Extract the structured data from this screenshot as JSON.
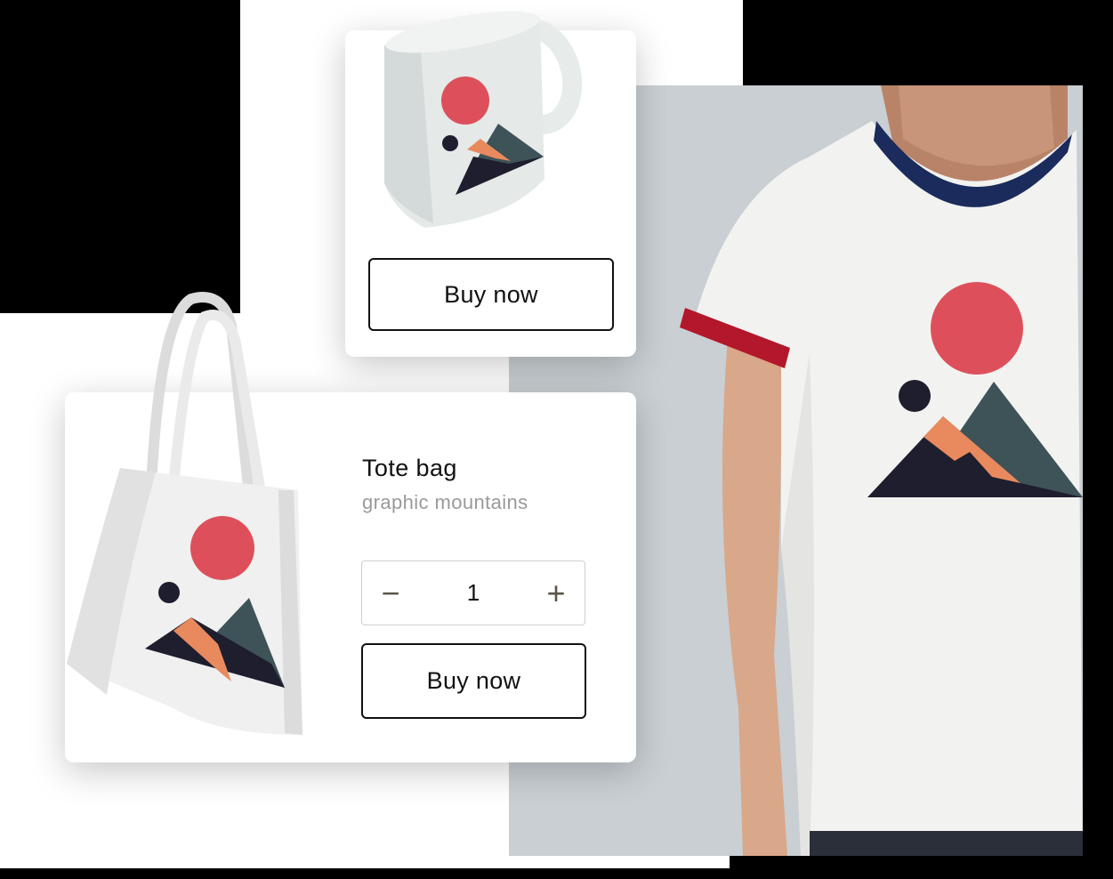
{
  "mug": {
    "buy_label": "Buy now",
    "image_icon": "mug-graphic-mountains"
  },
  "tote": {
    "title": "Tote bag",
    "subtitle": "graphic mountains",
    "quantity": "1",
    "decrement_symbol": "−",
    "increment_symbol": "+",
    "buy_label": "Buy now",
    "image_icon": "tote-bag-graphic-mountains"
  },
  "tshirt": {
    "image_icon": "tshirt-model-graphic-mountains"
  },
  "colors": {
    "sun": "#dd505b",
    "dark": "#1f1e2e",
    "peach": "#e9895e",
    "teal": "#3d5358",
    "collar": "#1a2b5c",
    "sleeve": "#b3172c",
    "panel": "#c9cfd3"
  }
}
